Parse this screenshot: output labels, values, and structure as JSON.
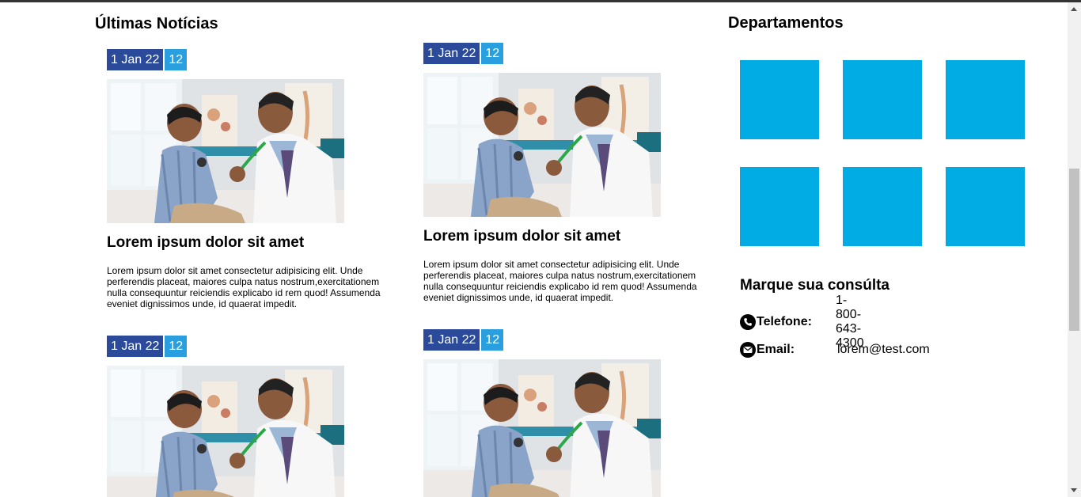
{
  "news_section": {
    "title": "Últimas Notícias"
  },
  "news": [
    {
      "date": "1 Jan 22",
      "count": "12",
      "title": "Lorem ipsum dolor sit amet",
      "body": "Lorem ipsum dolor sit amet consectetur adipisicing elit. Unde perferendis placeat, maiores culpa natus nostrum,exercitationem nulla consequuntur reiciendis explicabo id rem quod! Assumenda eveniet dignissimos unde, id quaerat impedit."
    },
    {
      "date": "1 Jan 22",
      "count": "12",
      "title": "Lorem ipsum dolor sit amet",
      "body": "Lorem ipsum dolor sit amet consectetur adipisicing elit. Unde perferendis placeat, maiores culpa natus nostrum,exercitationem nulla consequuntur reiciendis explicabo id rem quod! Assumenda eveniet dignissimos unde, id quaerat impedit."
    },
    {
      "date": "1 Jan 22",
      "count": "12"
    },
    {
      "date": "1 Jan 22",
      "count": "12"
    }
  ],
  "departments": {
    "title": "Departamentos",
    "tile_color": "#00ace3"
  },
  "booking": {
    "title": "Marque sua consúlta",
    "phone_label": "Telefone:",
    "phone_value": "1-800-643-4300",
    "email_label": "Email:",
    "email_value": "lorem@test.com"
  },
  "colors": {
    "date_badge": "#2b4a9a",
    "count_badge": "#2a9fdf"
  },
  "icons": {
    "phone": "phone-icon",
    "email": "envelope-icon"
  }
}
